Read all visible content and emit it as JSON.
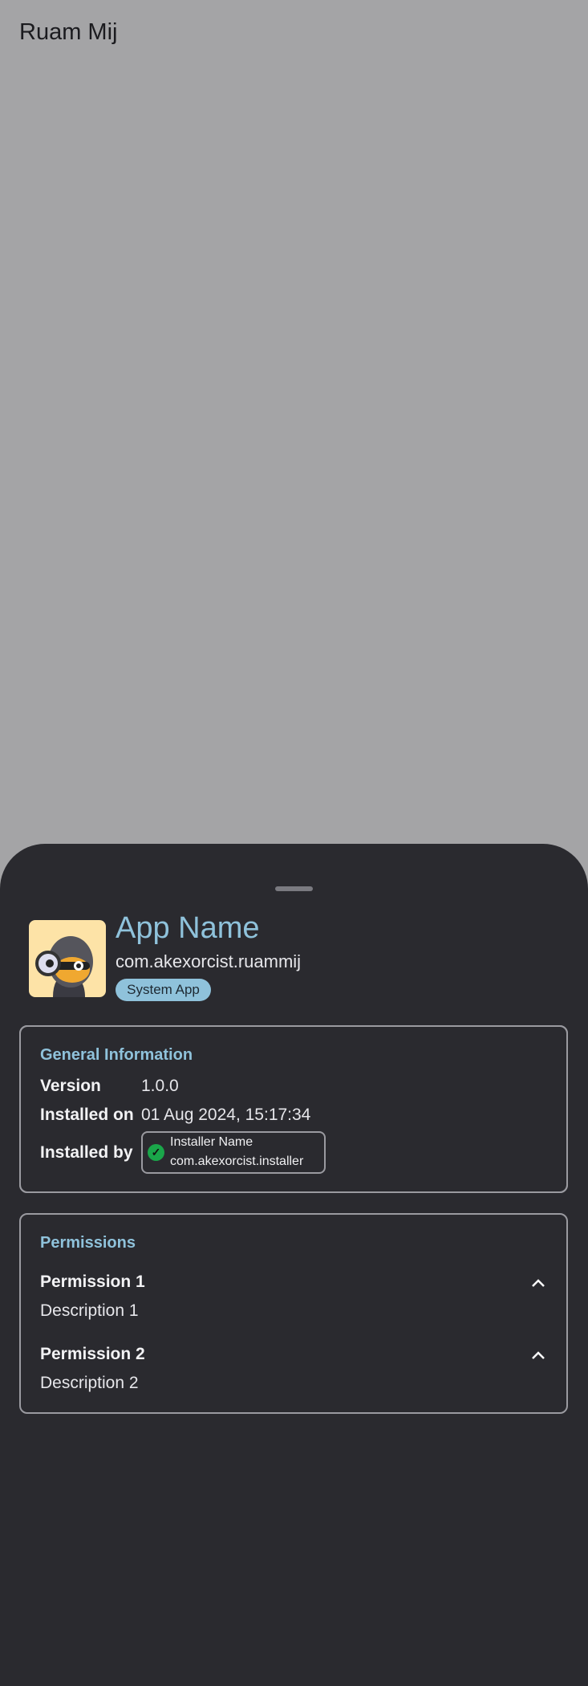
{
  "app_bar": {
    "title": "Ruam Mij"
  },
  "sheet": {
    "app_name": "App Name",
    "package": "com.akexorcist.ruammij",
    "badge": "System App",
    "general": {
      "title": "General Information",
      "version_label": "Version",
      "version": "1.0.0",
      "installed_on_label": "Installed on",
      "installed_on": "01 Aug 2024, 15:17:34",
      "installed_by_label": "Installed by",
      "installer_name": "Installer Name",
      "installer_package": "com.akexorcist.installer"
    },
    "permissions": {
      "title": "Permissions",
      "items": [
        {
          "name": "Permission 1",
          "description": "Description 1"
        },
        {
          "name": "Permission 2",
          "description": "Description 2"
        }
      ]
    }
  }
}
